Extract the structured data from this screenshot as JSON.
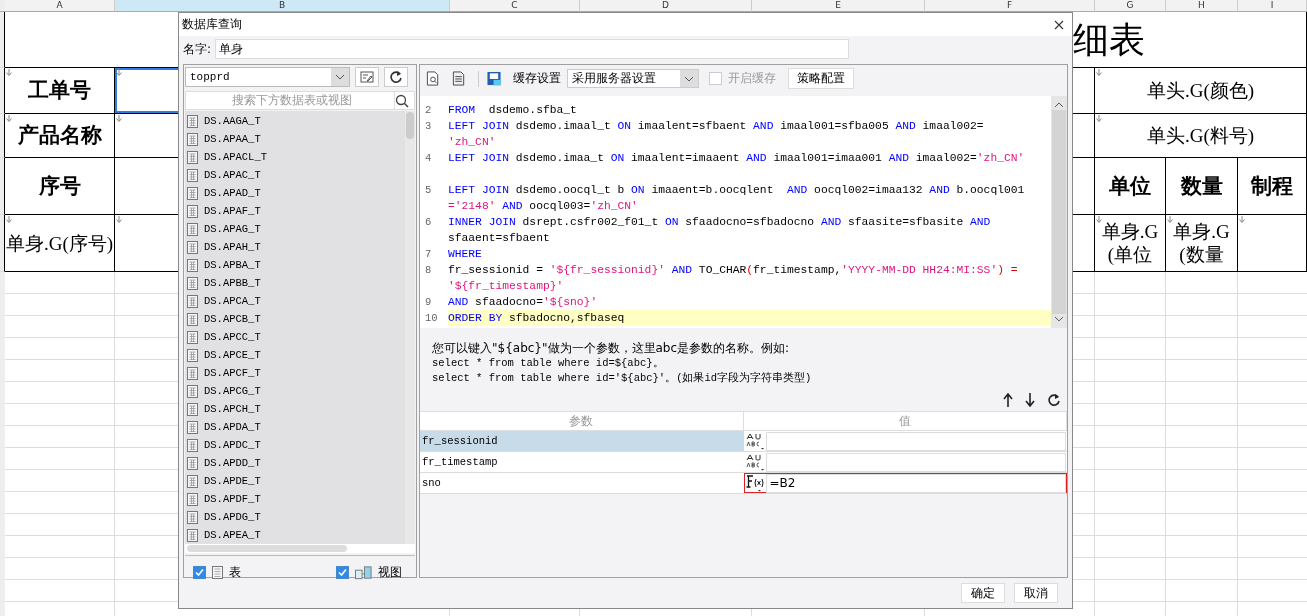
{
  "sheet": {
    "columns": [
      {
        "label": "A",
        "selected": false
      },
      {
        "label": "B",
        "selected": true
      },
      {
        "label": "C",
        "selected": false
      },
      {
        "label": "D",
        "selected": false
      },
      {
        "label": "E",
        "selected": false
      },
      {
        "label": "F",
        "selected": false
      },
      {
        "label": "G",
        "selected": false
      },
      {
        "label": "H",
        "selected": false
      },
      {
        "label": "I",
        "selected": false
      }
    ],
    "title": "细表",
    "labels": [
      {
        "text": "工单号",
        "bold": true
      },
      {
        "text": "产品名称",
        "bold": true
      },
      {
        "text": "序号",
        "bold": true
      },
      {
        "text": "单身.G(序号)",
        "bold": false
      }
    ],
    "value_cells": [
      {
        "selected": true
      },
      {
        "selected": false
      },
      {
        "selected": false
      },
      {
        "selected": false
      }
    ],
    "header_fields": [
      "单头.G(颜色)",
      "单头.G(料号)"
    ],
    "detail_headers": [
      "单位",
      "数量",
      "制程"
    ],
    "detail_fields": [
      "单身.G(单位",
      "单身.G(数量"
    ]
  },
  "dialog": {
    "title": "数据库查询",
    "name_label": "名字:",
    "name_value": "单身",
    "connection": {
      "value": "topprd"
    },
    "search": {
      "placeholder": "搜索下方数据表或视图"
    },
    "tables": [
      "DS.AAGA_T",
      "DS.APAA_T",
      "DS.APACL_T",
      "DS.APAC_T",
      "DS.APAD_T",
      "DS.APAF_T",
      "DS.APAG_T",
      "DS.APAH_T",
      "DS.APBA_T",
      "DS.APBB_T",
      "DS.APCA_T",
      "DS.APCB_T",
      "DS.APCC_T",
      "DS.APCE_T",
      "DS.APCF_T",
      "DS.APCG_T",
      "DS.APCH_T",
      "DS.APDA_T",
      "DS.APDC_T",
      "DS.APDD_T",
      "DS.APDE_T",
      "DS.APDF_T",
      "DS.APDG_T",
      "DS.APEA_T"
    ],
    "filters": [
      {
        "kind": "table",
        "label": "表",
        "checked": true
      },
      {
        "kind": "view",
        "label": "视图",
        "checked": true
      }
    ],
    "toolbar": {
      "cache_label": "缓存设置",
      "cache_mode": "采用服务器设置",
      "enable_cache": {
        "label": "开启缓存",
        "checked": false,
        "disabled": true
      },
      "strategy_button": "策略配置"
    },
    "sql_rows": [
      {
        "number": "2",
        "current": false,
        "tokens": [
          {
            "kind": "keyword",
            "text": "FROM"
          },
          {
            "kind": "plain",
            "text": "  dsdemo.sfba_t"
          }
        ]
      },
      {
        "number": "3",
        "current": false,
        "tokens": [
          {
            "kind": "keyword",
            "text": "LEFT JOIN"
          },
          {
            "kind": "plain",
            "text": " dsdemo.imaal_t "
          },
          {
            "kind": "keyword",
            "text": "ON"
          },
          {
            "kind": "plain",
            "text": " imaalent=sfbaent "
          },
          {
            "kind": "keyword",
            "text": "AND"
          },
          {
            "kind": "plain",
            "text": " imaal001=sfba005 "
          },
          {
            "kind": "keyword",
            "text": "AND"
          },
          {
            "kind": "plain",
            "text": " imaal002="
          }
        ]
      },
      {
        "current": false,
        "tokens": [
          {
            "kind": "string",
            "text": "'zh_CN'"
          }
        ]
      },
      {
        "number": "4",
        "current": false,
        "tokens": [
          {
            "kind": "keyword",
            "text": "LEFT JOIN"
          },
          {
            "kind": "plain",
            "text": " dsdemo.imaa_t "
          },
          {
            "kind": "keyword",
            "text": "ON"
          },
          {
            "kind": "plain",
            "text": " imaalent=imaaent "
          },
          {
            "kind": "keyword",
            "text": "AND"
          },
          {
            "kind": "plain",
            "text": " imaal001=imaa001 "
          },
          {
            "kind": "keyword",
            "text": "AND"
          },
          {
            "kind": "plain",
            "text": " imaal002="
          },
          {
            "kind": "string",
            "text": "'zh_CN'"
          }
        ]
      },
      {
        "current": false,
        "tokens": []
      },
      {
        "number": "5",
        "current": false,
        "tokens": [
          {
            "kind": "keyword",
            "text": "LEFT JOIN"
          },
          {
            "kind": "plain",
            "text": " dsdemo.oocql_t b "
          },
          {
            "kind": "keyword",
            "text": "ON"
          },
          {
            "kind": "plain",
            "text": " imaaent=b.oocqlent  "
          },
          {
            "kind": "keyword",
            "text": "AND"
          },
          {
            "kind": "plain",
            "text": " oocql002=imaa132 "
          },
          {
            "kind": "keyword",
            "text": "AND"
          },
          {
            "kind": "plain",
            "text": " b.oocql001"
          }
        ]
      },
      {
        "current": false,
        "tokens": [
          {
            "kind": "string",
            "text": "='2148'"
          },
          {
            "kind": "keyword",
            "text": " AND"
          },
          {
            "kind": "plain",
            "text": " oocql003="
          },
          {
            "kind": "string",
            "text": "'zh_CN'"
          }
        ]
      },
      {
        "number": "6",
        "current": false,
        "tokens": [
          {
            "kind": "keyword",
            "text": "INNER JOIN"
          },
          {
            "kind": "plain",
            "text": " dsrept.csfr002_f01_t "
          },
          {
            "kind": "keyword",
            "text": "ON"
          },
          {
            "kind": "plain",
            "text": " sfaadocno=sfbadocno "
          },
          {
            "kind": "keyword",
            "text": "AND"
          },
          {
            "kind": "plain",
            "text": " sfaasite=sfbasite "
          },
          {
            "kind": "keyword",
            "text": "AND"
          }
        ]
      },
      {
        "current": false,
        "tokens": [
          {
            "kind": "plain",
            "text": "sfaaent=sfbaent"
          }
        ]
      },
      {
        "number": "7",
        "current": false,
        "tokens": [
          {
            "kind": "keyword",
            "text": "WHERE"
          }
        ]
      },
      {
        "number": "8",
        "current": false,
        "tokens": [
          {
            "kind": "plain",
            "text": "fr_sessionid = "
          },
          {
            "kind": "string",
            "text": "'${fr_sessionid}'"
          },
          {
            "kind": "keyword",
            "text": " AND"
          },
          {
            "kind": "plain",
            "text": " TO_CHAR"
          },
          {
            "kind": "operator",
            "text": "("
          },
          {
            "kind": "plain",
            "text": "fr_timestamp,"
          },
          {
            "kind": "string",
            "text": "'YYYY-MM-DD HH24:MI:SS'"
          },
          {
            "kind": "operator",
            "text": ") ="
          }
        ]
      },
      {
        "current": false,
        "tokens": [
          {
            "kind": "string",
            "text": "'${fr_timestamp}'"
          }
        ]
      },
      {
        "number": "9",
        "current": false,
        "tokens": [
          {
            "kind": "keyword",
            "text": "AND"
          },
          {
            "kind": "plain",
            "text": " sfaadocno="
          },
          {
            "kind": "string",
            "text": "'${sno}'"
          }
        ]
      },
      {
        "number": "10",
        "current": true,
        "tokens": [
          {
            "kind": "keyword",
            "text": "ORDER BY"
          },
          {
            "kind": "plain",
            "text": " sfbadocno,sfbaseq"
          }
        ]
      }
    ],
    "hint": [
      {
        "kind": "note",
        "text": "您可以键入\"${abc}\"做为一个参数，这里abc是参数的名称。例如:"
      },
      {
        "kind": "example",
        "text": "select * from table where id=${abc}。"
      },
      {
        "kind": "example",
        "text": "select * from table where id='${abc}'。(如果id字段为字符串类型)"
      }
    ],
    "parameters": {
      "columns": [
        "参数",
        "值"
      ],
      "rows": [
        {
          "name": "fr_sessionid",
          "kind": "text",
          "selected": true,
          "editing": false
        },
        {
          "name": "fr_timestamp",
          "kind": "text",
          "selected": false,
          "editing": false
        },
        {
          "name": "sno",
          "kind": "formula",
          "value": "=B2",
          "selected": false,
          "editing": true
        }
      ]
    },
    "buttons": [
      "确定",
      "取消"
    ]
  }
}
